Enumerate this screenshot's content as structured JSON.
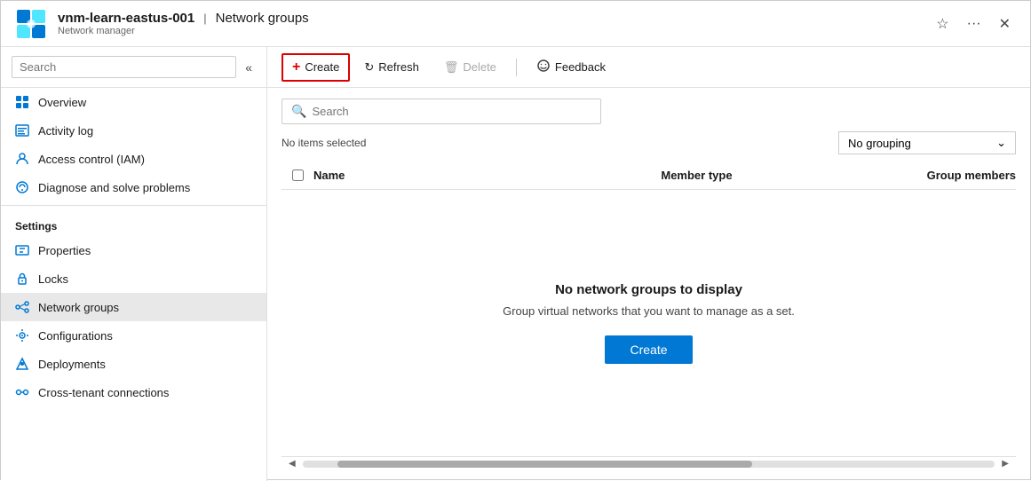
{
  "header": {
    "resource_name": "vnm-learn-eastus-001",
    "separator": "|",
    "page_title": "Network groups",
    "sub_label": "Network manager",
    "star_icon": "☆",
    "more_icon": "···",
    "close_icon": "✕"
  },
  "sidebar": {
    "search_placeholder": "Search",
    "collapse_icon": "«",
    "nav_items": [
      {
        "label": "Overview",
        "icon": "overview"
      },
      {
        "label": "Activity log",
        "icon": "activity-log"
      },
      {
        "label": "Access control (IAM)",
        "icon": "access-control"
      },
      {
        "label": "Diagnose and solve problems",
        "icon": "diagnose"
      }
    ],
    "settings_section": "Settings",
    "settings_items": [
      {
        "label": "Properties",
        "icon": "properties"
      },
      {
        "label": "Locks",
        "icon": "locks"
      },
      {
        "label": "Network groups",
        "icon": "network-groups",
        "active": true
      },
      {
        "label": "Configurations",
        "icon": "configurations"
      },
      {
        "label": "Deployments",
        "icon": "deployments"
      },
      {
        "label": "Cross-tenant connections",
        "icon": "cross-tenant"
      }
    ]
  },
  "toolbar": {
    "create_label": "Create",
    "refresh_label": "Refresh",
    "delete_label": "Delete",
    "feedback_label": "Feedback"
  },
  "content": {
    "search_placeholder": "Search",
    "no_items_text": "No items selected",
    "grouping_label": "No grouping",
    "table": {
      "col_name": "Name",
      "col_member_type": "Member type",
      "col_group_members": "Group members"
    },
    "empty_state": {
      "title": "No network groups to display",
      "description": "Group virtual networks that you want to manage as a set.",
      "create_label": "Create"
    }
  }
}
